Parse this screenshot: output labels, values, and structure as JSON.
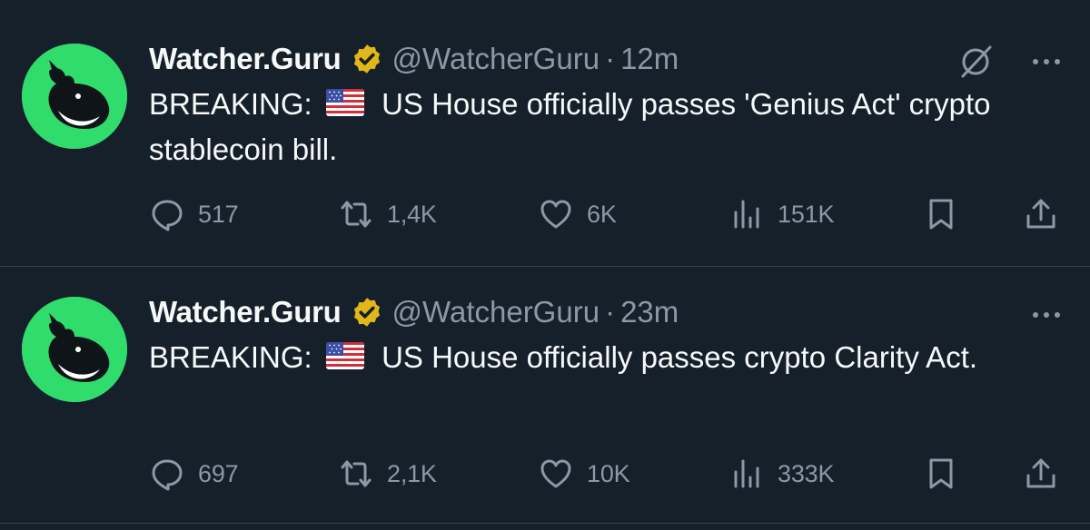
{
  "colors": {
    "background": "#15202b",
    "text_primary": "#f7f9f9",
    "text_secondary": "#8b98a5",
    "divider": "#38444d",
    "avatar_bg": "#2fdc6c",
    "verified_gold": "#e2b719"
  },
  "tweets": [
    {
      "author_name": "Watcher.Guru",
      "handle": "@WatcherGuru",
      "separator": "·",
      "time": "12m",
      "text_prefix": "BREAKING:",
      "flag_icon": "us-flag-icon",
      "text_body": "US House officially passes 'Genius Act' crypto stablecoin bill.",
      "replies": "517",
      "reposts": "1,4K",
      "likes": "6K",
      "views": "151K",
      "show_grok": true
    },
    {
      "author_name": "Watcher.Guru",
      "handle": "@WatcherGuru",
      "separator": "·",
      "time": "23m",
      "text_prefix": "BREAKING:",
      "flag_icon": "us-flag-icon",
      "text_body": "US House officially passes crypto Clarity Act.",
      "replies": "697",
      "reposts": "2,1K",
      "likes": "10K",
      "views": "333K",
      "show_grok": false
    }
  ]
}
